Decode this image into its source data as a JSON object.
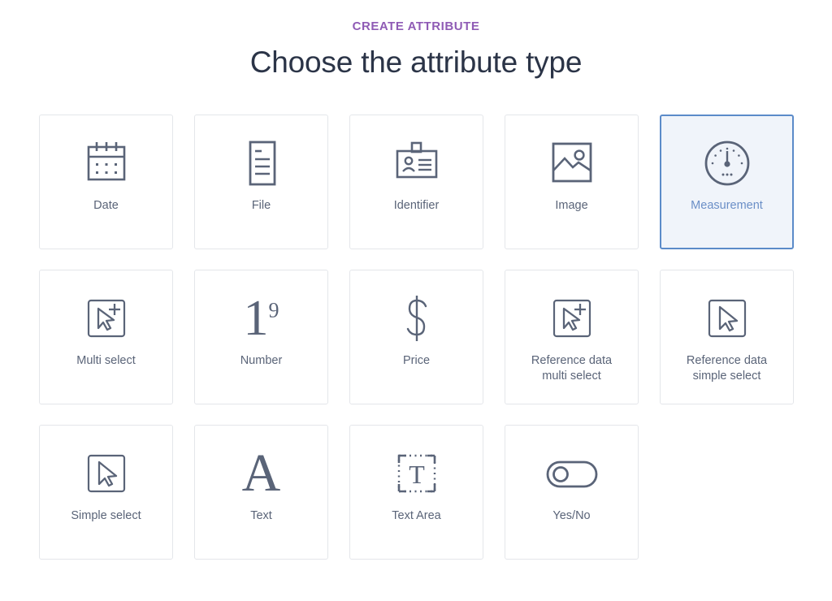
{
  "header": {
    "eyebrow": "CREATE ATTRIBUTE",
    "title": "Choose the attribute type"
  },
  "colors": {
    "eyebrow": "#8f5bb5",
    "title": "#2b3447",
    "card_border": "#e4e6ea",
    "card_label": "#5a6478",
    "selected_border": "#5b8bc9",
    "selected_background": "#f0f4fa",
    "selected_label": "#6b8fc7",
    "icon_stroke": "#5a6478",
    "page_background": "#ffffff"
  },
  "grid": {
    "rows": [
      [
        {
          "label": "Date",
          "icon": "calendar-icon",
          "selected": false
        },
        {
          "label": "File",
          "icon": "document-lines-icon",
          "selected": false
        },
        {
          "label": "Identifier",
          "icon": "id-badge-icon",
          "selected": false
        },
        {
          "label": "Image",
          "icon": "picture-icon",
          "selected": false
        },
        {
          "label": "Measurement",
          "icon": "gauge-icon",
          "selected": true
        }
      ],
      [
        {
          "label": "Multi select",
          "icon": "cursor-plus-box-icon",
          "selected": false
        },
        {
          "label": "Number",
          "icon": "numeral-one-nine-icon",
          "selected": false
        },
        {
          "label": "Price",
          "icon": "dollar-sign-icon",
          "selected": false
        },
        {
          "label": "Reference data\nmulti select",
          "icon": "cursor-plus-box-icon",
          "selected": false
        },
        {
          "label": "Reference data\nsimple select",
          "icon": "cursor-box-icon",
          "selected": false
        }
      ],
      [
        {
          "label": "Simple select",
          "icon": "cursor-box-icon",
          "selected": false
        },
        {
          "label": "Text",
          "icon": "letter-a-icon",
          "selected": false
        },
        {
          "label": "Text Area",
          "icon": "dashed-box-letter-t-icon",
          "selected": false
        },
        {
          "label": "Yes/No",
          "icon": "toggle-switch-icon",
          "selected": false
        }
      ]
    ]
  },
  "selection": {
    "selected_attribute_type": "Measurement"
  }
}
